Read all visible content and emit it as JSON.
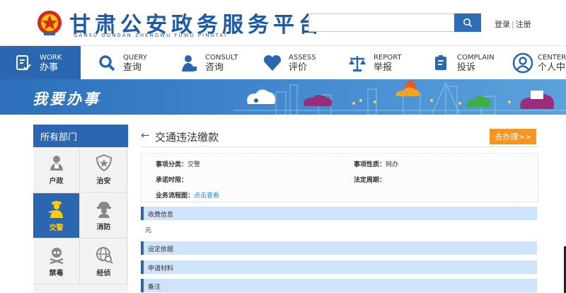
{
  "header": {
    "title": "甘肃公安政务服务平台",
    "pinyin": "GANSU  GONGAN  ZHENGWU  FUWU  PINGTAI",
    "search_placeholder": "",
    "login_label": "登录",
    "separator": "|",
    "register_label": "注册"
  },
  "nav": {
    "items": [
      {
        "en": "WORK",
        "cn": "办事",
        "icon": "document-check-icon"
      },
      {
        "en": "QUERY",
        "cn": "查询",
        "icon": "search-icon"
      },
      {
        "en": "CONSULT",
        "cn": "咨询",
        "icon": "consult-person-icon"
      },
      {
        "en": "ASSESS",
        "cn": "评价",
        "icon": "heart-icon"
      },
      {
        "en": "REPORT",
        "cn": "举报",
        "icon": "scale-icon"
      },
      {
        "en": "COMPLAIN",
        "cn": "投诉",
        "icon": "clipboard-icon"
      },
      {
        "en": "CENTER",
        "cn": "个人中心",
        "icon": "user-icon"
      }
    ]
  },
  "banner": {
    "title": "我要办事"
  },
  "sidebar": {
    "heading": "所有部门",
    "departments": [
      {
        "label": "户政",
        "icon": "household-person-icon"
      },
      {
        "label": "治安",
        "icon": "police-badge-icon"
      },
      {
        "label": "交警",
        "icon": "traffic-police-icon"
      },
      {
        "label": "消防",
        "icon": "firefighter-icon"
      },
      {
        "label": "禁毒",
        "icon": "skull-icon"
      },
      {
        "label": "经侦",
        "icon": "globe-search-icon"
      }
    ]
  },
  "main": {
    "title": "交通违法缴款",
    "go_button": "去办理>>",
    "info": {
      "category_key": "事项分类：",
      "category_value": "交警",
      "nature_key": "事项性质：",
      "nature_value": "网办",
      "promise_key": "承诺时限：",
      "promise_value": "",
      "legal_key": "法定周期：",
      "legal_value": "",
      "flow_key": "业务流程图：",
      "flow_link": "点击查看"
    },
    "sections": [
      {
        "title": "收费信息",
        "body": "元"
      },
      {
        "title": "设定依据",
        "body": ""
      },
      {
        "title": "申请材料",
        "body": ""
      },
      {
        "title": "备注",
        "body": ""
      }
    ]
  },
  "colors": {
    "brand_blue": "#2b67b0",
    "accent_orange": "#f7951e",
    "section_bg": "#cfe4f8",
    "link": "#2b8ad9"
  }
}
